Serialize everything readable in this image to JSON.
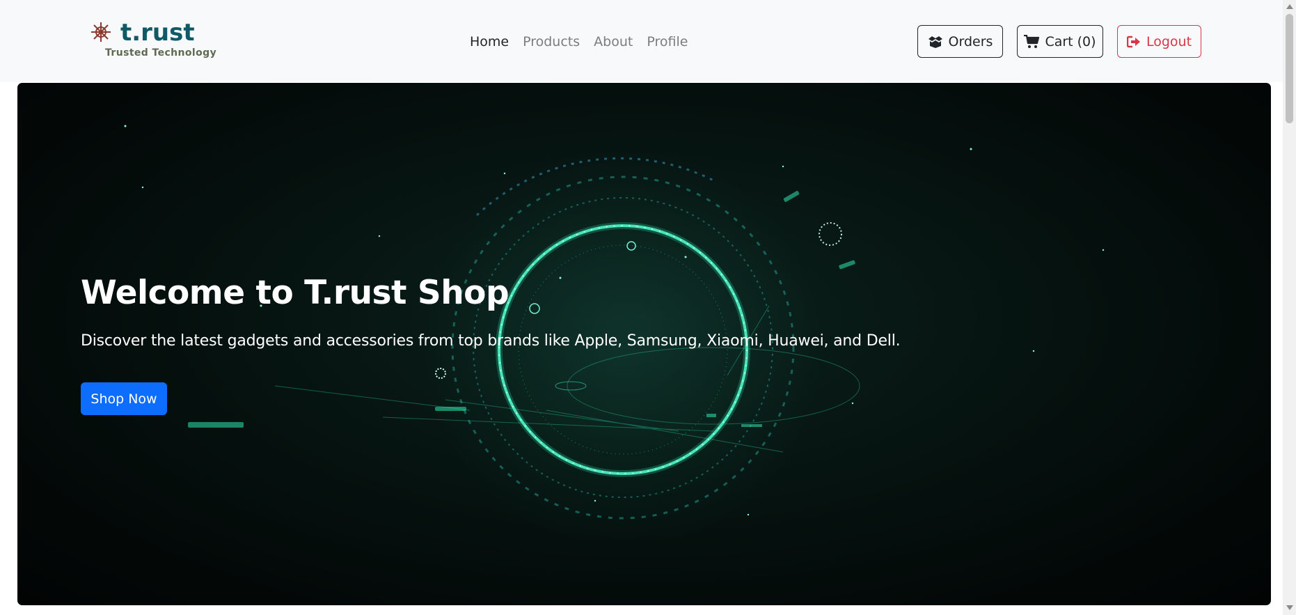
{
  "brand": {
    "name": "t.rust",
    "tagline": "Trusted Technology",
    "logo_icon": "ship-wheel-icon",
    "color": "#0f5a66"
  },
  "nav": {
    "links": [
      {
        "label": "Home",
        "active": true
      },
      {
        "label": "Products",
        "active": false
      },
      {
        "label": "About",
        "active": false
      },
      {
        "label": "Profile",
        "active": false
      }
    ]
  },
  "actions": {
    "orders": {
      "label": "Orders",
      "icon": "box-icon"
    },
    "cart": {
      "label": "Cart (0)",
      "icon": "cart-icon"
    },
    "logout": {
      "label": "Logout",
      "icon": "sign-out-icon",
      "color": "#dc3545"
    }
  },
  "hero": {
    "title": "Welcome to T.rust Shop",
    "subtitle": "Discover the latest gadgets and accessories from top brands like Apple, Samsung, Xiaomi, Huawei, and Dell.",
    "cta": "Shop Now",
    "cta_color": "#0d6efd",
    "accent": "#2ee6b0"
  }
}
